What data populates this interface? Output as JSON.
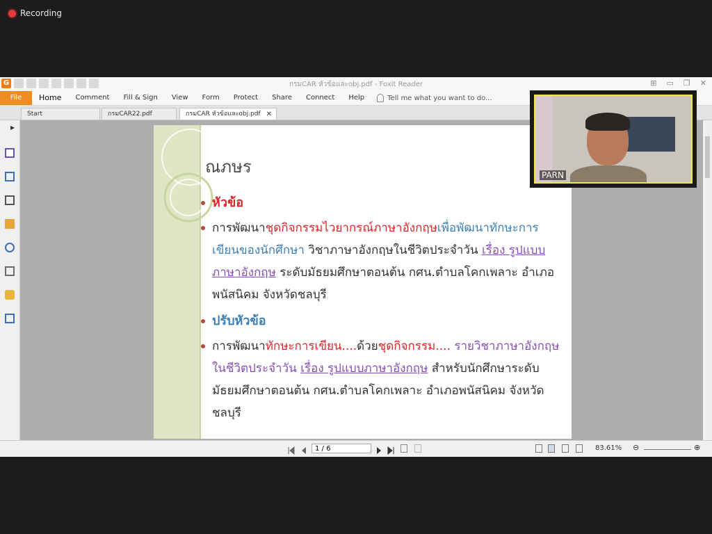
{
  "recording": {
    "label": "Recording"
  },
  "app": {
    "title": "กรมCAR หัวข้อและobj.pdf - Foxit Reader",
    "menu": {
      "file": "File",
      "items": [
        "Home",
        "Comment",
        "Fill & Sign",
        "View",
        "Form",
        "Protect",
        "Share",
        "Connect",
        "Help"
      ],
      "tell_me": "Tell me what you want to do..."
    },
    "tabs": [
      {
        "label": "Start"
      },
      {
        "label": "กรมCAR22.pdf"
      },
      {
        "label": "กรมCAR หัวข้อและobj.pdf"
      }
    ]
  },
  "slide": {
    "title": "ณภษร",
    "bullets": {
      "b1": "หัวข้อ",
      "b2": {
        "p1": "การพัฒนา",
        "p2": "ชุดกิจกรรมไวยากรณ์ภาษาอังกฤษ",
        "p3": "เพื่อพัฒนาทักษะการเขียนของนักศึกษา",
        "p4": " วิชาภาษาอังกฤษในชีวิตประจำวัน ",
        "p5": "เรื่อง รูปแบบภาษาอังกฤษ",
        "p6": " ระดับมัธยมศึกษาตอนต้น กศน.ตำบลโคกเพลาะ อำเภอพนัสนิคม จังหวัดชลบุรี"
      },
      "b3": "ปรับหัวข้อ",
      "b4": {
        "p1": "การพัฒนา",
        "p2": "ทักษะการเขียน....",
        "p3": "ด้วย",
        "p4": "ชุดกิจกรรม.... ",
        "p5": "รายวิชาภาษาอังกฤษในชีวิตประจำวัน ",
        "p6": "เรื่อง รูปแบบภาษาอังกฤษ",
        "p7": " สำหรับนักศึกษาระดับมัธยมศึกษาตอนต้น กศน.ตำบลโคกเพลาะ อำเภอพนัสนิคม จังหวัดชลบุรี"
      }
    }
  },
  "status": {
    "page": "1 / 6",
    "zoom": "83.61%"
  },
  "video": {
    "name": "PARN"
  }
}
